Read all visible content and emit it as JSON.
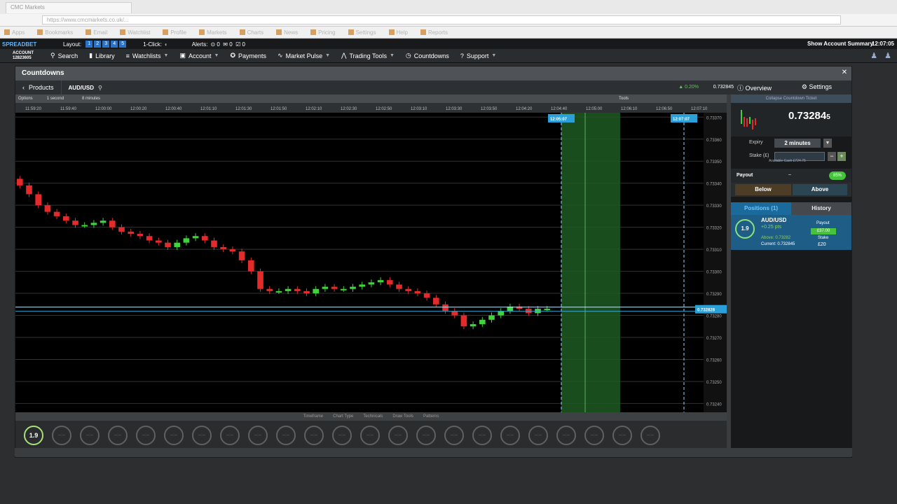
{
  "browser": {
    "tab_title": "CMC Markets",
    "url": "https://www.cmcmarkets.co.uk/...",
    "bookmarks": [
      "Apps",
      "Bookmarks",
      "Email",
      "Watchlist",
      "Profile",
      "Markets",
      "Charts",
      "News",
      "Pricing",
      "Settings",
      "Help",
      "Reports"
    ]
  },
  "app": {
    "logo": "SPREADBET",
    "layout_label": "Layout:",
    "layout_buttons": [
      "1",
      "2",
      "3",
      "4",
      "5"
    ],
    "oneclick_label": "1-Click:",
    "alerts_label": "Alerts:",
    "alerts_counts": [
      "0",
      "0",
      "0"
    ],
    "account_summary": "Show Account Summary",
    "clock": "12:07:05",
    "account_label": "ACCOUNT",
    "account_number": "12823605"
  },
  "nav": {
    "search": "Search",
    "library": "Library",
    "watchlists": "Watchlists",
    "account": "Account",
    "payments": "Payments",
    "market_pulse": "Market Pulse",
    "trading_tools": "Trading Tools",
    "countdowns": "Countdowns",
    "support": "Support"
  },
  "window": {
    "title": "Countdowns",
    "products": "Products",
    "market": "AUD/USD",
    "change": "▲ 0.20%",
    "price": "0.732845",
    "overview": "Overview",
    "settings": "Settings"
  },
  "chart_tools": {
    "options": "Options",
    "interval": "1 second",
    "duration": "8 minutes",
    "tools": "Tools",
    "bottom": [
      "Timeframe",
      "Chart Type",
      "Technicals",
      "Draw Tools",
      "Patterns"
    ]
  },
  "chart_data": {
    "type": "candlestick",
    "x_ticks": [
      "11:59:20",
      "11:59:40",
      "12:00:00",
      "12:00:20",
      "12:00:40",
      "12:01:10",
      "12:01:30",
      "12:01:50",
      "12:02:10",
      "12:02:30",
      "12:02:50",
      "12:03:10",
      "12:03:30",
      "12:03:50",
      "12:04:20",
      "12:04:40",
      "12:05:00",
      "12:06:10",
      "12:06:50",
      "12:07:10"
    ],
    "y_ticks": [
      "0.73370",
      "0.73360",
      "0.73350",
      "0.73340",
      "0.73330",
      "0.73320",
      "0.73310",
      "0.73300",
      "0.73290",
      "0.73280",
      "0.73270",
      "0.73260",
      "0.73250",
      "0.73240"
    ],
    "ylim": [
      0.73236,
      0.73372
    ],
    "start_marker": "12:05:07",
    "end_marker": "12:07:07",
    "current_price": "0.732828",
    "strike_label": "0.73282",
    "up_color": "#3fd43a",
    "down_color": "#e32b2b",
    "close_series": [
      0.73339,
      0.73335,
      0.7333,
      0.73327,
      0.73325,
      0.73323,
      0.73321,
      0.73321,
      0.73322,
      0.73323,
      0.7332,
      0.73318,
      0.73317,
      0.73316,
      0.73314,
      0.73313,
      0.73311,
      0.73313,
      0.73315,
      0.73316,
      0.73314,
      0.73311,
      0.7331,
      0.73309,
      0.73305,
      0.733,
      0.73292,
      0.73291,
      0.73291,
      0.73292,
      0.73291,
      0.7329,
      0.73292,
      0.73293,
      0.73292,
      0.73292,
      0.73293,
      0.73294,
      0.73295,
      0.73296,
      0.73294,
      0.73292,
      0.73291,
      0.7329,
      0.73288,
      0.73285,
      0.73282,
      0.7328,
      0.73275,
      0.73276,
      0.73278,
      0.7328,
      0.73282,
      0.73284,
      0.73283,
      0.73281,
      0.73283,
      0.73283
    ]
  },
  "ticket": {
    "title": "Collapse Countdown Ticket",
    "price_main": "0.73284",
    "price_small": "5",
    "expiry_label": "Expiry",
    "expiry_value": "2 minutes",
    "stake_label": "Stake (£)",
    "available_cash": "Available Cash £724.75",
    "payout_label": "Payout",
    "payout_value": "–",
    "payout_pct": "85%",
    "below": "Below",
    "above": "Above",
    "positions_tab": "Positions (1)",
    "history_tab": "History",
    "pos_ring": "1.9",
    "pos_name": "AUD/USD",
    "pos_pts": "+0.25 pts",
    "pos_above": "Above: 0.73282",
    "pos_current": "Current: 0.732845",
    "pos_payout_label": "Payout",
    "pos_payout_value": "£37.00",
    "pos_stake_label": "Stake",
    "pos_stake_value": "£20"
  },
  "tiles": {
    "active": "1.9",
    "placeholder": "--:--",
    "count": 23
  }
}
